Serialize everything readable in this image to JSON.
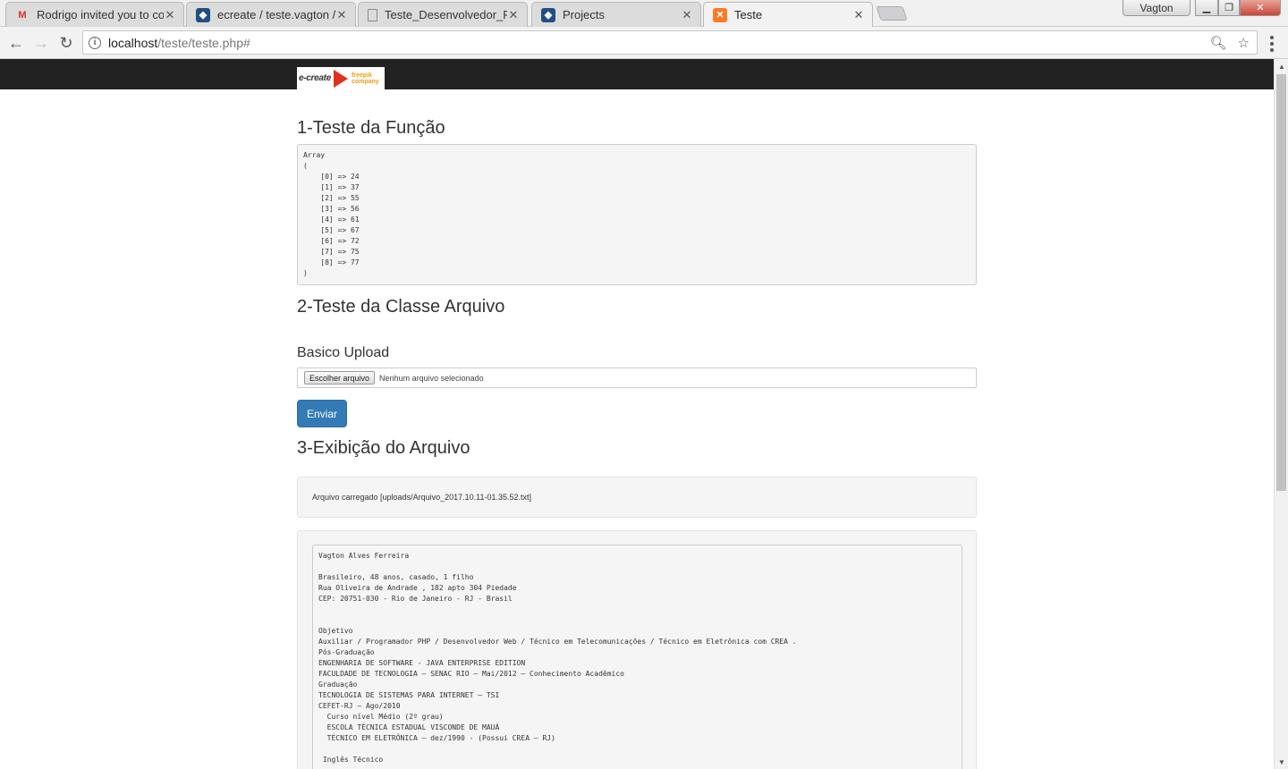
{
  "browser": {
    "tabs": [
      {
        "title": "Rodrigo invited you to co",
        "icon": "gmail-icon",
        "active": false
      },
      {
        "title": "ecreate / teste.vagton / s",
        "icon": "bitbucket-icon",
        "active": false
      },
      {
        "title": "Teste_Desenvolvedor_PH",
        "icon": "document-icon",
        "active": false
      },
      {
        "title": "Projects",
        "icon": "bitbucket-icon",
        "active": false
      },
      {
        "title": "Teste",
        "icon": "xampp-icon",
        "active": true
      }
    ],
    "profile_name": "Vagton",
    "url_host": "localhost",
    "url_path": "/teste/teste.php#"
  },
  "page": {
    "logo_left": "e-create",
    "logo_right": "freepik\ncompany",
    "section1_title": "1-Teste da Função",
    "array_output": "Array\n(\n    [0] => 24\n    [1] => 37\n    [2] => 55\n    [3] => 56\n    [4] => 61\n    [5] => 67\n    [6] => 72\n    [7] => 75\n    [8] => 77\n)",
    "section2_title": "2-Teste da Classe Arquivo",
    "upload_label": "Basico Upload",
    "file_button_label": "Escolher arquivo",
    "file_status": "Nenhum arquivo selecionado",
    "submit_label": "Enviar",
    "section3_title": "3-Exibição do Arquivo",
    "upload_message": "Arquivo carregado [uploads/Arquivo_2017.10.11-01.35.52.txt]",
    "file_content": "Vagton Alves Ferreira\n\nBrasileiro, 48 anos, casado, 1 filho\nRua Oliveira de Andrade , 182 apto 304 Piedade\nCEP: 20751-030 - Rio de Janeiro - RJ - Brasil\n\n\nObjetivo\nAuxiliar / Programador PHP / Desenvolvedor Web / Técnico em Telecomunicações / Técnico em Eletrônica com CREA .\nPós-Graduação\nENGENHARIA DE SOFTWARE - JAVA ENTERPRISE EDITION\nFACULDADE DE TECNOLOGIA – SENAC RIO – Mai/2012 – Conhecimento Acadêmico\nGraduação\nTECNOLOGIA DE SISTEMAS PARA INTERNET – TSI\nCEFET-RJ – Ago/2010\n  Curso nível Médio (2º grau)\n  ESCOLA TÉCNICA ESTADUAL VISCONDE DE MAUÁ\n  TÉCNICO EM ELETRÔNICA – dez/1990 - (Possui CREA – RJ)\n\n Inglês Técnico"
  },
  "colors": {
    "navbar": "#222222",
    "primary_button": "#337ab7",
    "well_bg": "#f5f5f5"
  }
}
